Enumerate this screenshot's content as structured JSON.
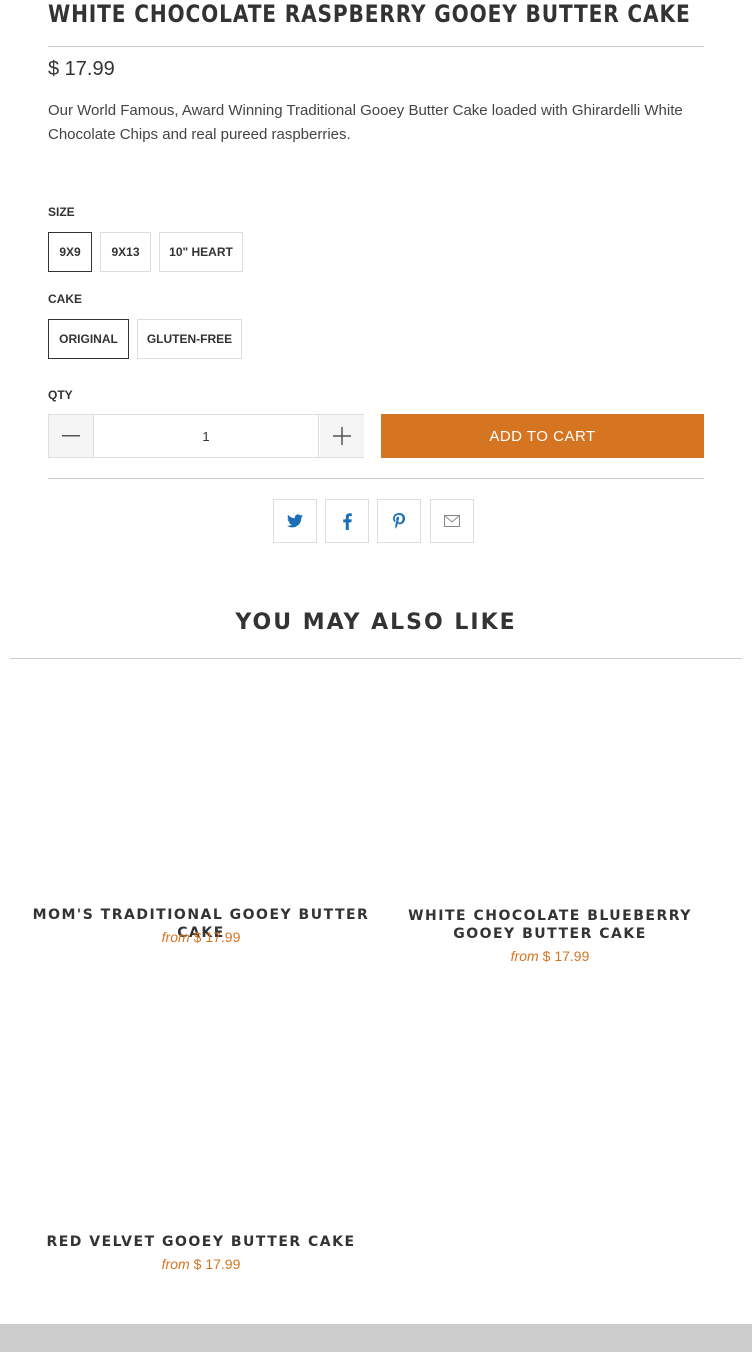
{
  "product": {
    "title": "WHITE CHOCOLATE RASPBERRY GOOEY BUTTER CAKE",
    "price": "$ 17.99",
    "description": "Our World Famous, Award Winning Traditional Gooey Butter Cake loaded with Ghirardelli White Chocolate Chips and real pureed raspberries."
  },
  "options": {
    "size_label": "SIZE",
    "sizes": [
      "9X9",
      "9X13",
      "10\" HEART"
    ],
    "cake_label": "CAKE",
    "cakes": [
      "ORIGINAL",
      "GLUTEN-FREE"
    ]
  },
  "quantity": {
    "label": "QTY",
    "value": "1",
    "minus_icon": "minus-icon",
    "plus_icon": "plus-icon"
  },
  "add_to_cart": "ADD TO CART",
  "share_icons": [
    "twitter-icon",
    "facebook-icon",
    "pinterest-icon",
    "email-icon"
  ],
  "related": {
    "heading": "YOU MAY ALSO LIKE",
    "from_label": "from",
    "items": [
      {
        "title": "MOM'S TRADITIONAL GOOEY BUTTER CAKE",
        "price": "$ 17.99"
      },
      {
        "title": "WHITE CHOCOLATE BLUEBERRY GOOEY BUTTER CAKE",
        "price": "$ 17.99"
      },
      {
        "title": "RED VELVET GOOEY BUTTER CAKE",
        "price": "$ 17.99"
      }
    ]
  },
  "colors": {
    "accent": "#d57521",
    "share_icon": "#1a6fb5",
    "text": "#333333"
  }
}
